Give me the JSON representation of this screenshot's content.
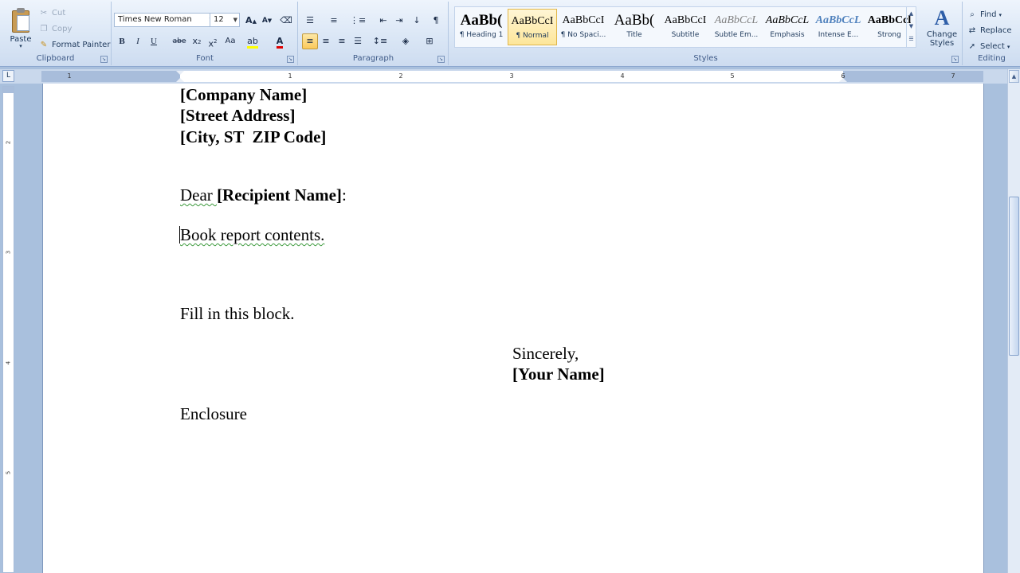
{
  "clipboard": {
    "paste_label": "Paste",
    "cut_label": "Cut",
    "copy_label": "Copy",
    "format_painter_label": "Format Painter",
    "group_label": "Clipboard"
  },
  "font": {
    "family": "Times New Roman",
    "size": "12",
    "group_label": "Font"
  },
  "paragraph": {
    "group_label": "Paragraph"
  },
  "styles": {
    "group_label": "Styles",
    "items": [
      {
        "sample": "AaBb(",
        "name": "¶ Heading 1"
      },
      {
        "sample": "AaBbCcI",
        "name": "¶ Normal"
      },
      {
        "sample": "AaBbCcI",
        "name": "¶ No Spaci..."
      },
      {
        "sample": "AaBb(",
        "name": "Title"
      },
      {
        "sample": "AaBbCcI",
        "name": "Subtitle"
      },
      {
        "sample": "AaBbCcL",
        "name": "Subtle Em..."
      },
      {
        "sample": "AaBbCcL",
        "name": "Emphasis"
      },
      {
        "sample": "AaBbCcL",
        "name": "Intense E..."
      },
      {
        "sample": "AaBbCcl",
        "name": "Strong"
      }
    ],
    "change_styles_line1": "Change",
    "change_styles_line2": "Styles"
  },
  "editing": {
    "find_label": "Find",
    "replace_label": "Replace",
    "select_label": "Select",
    "group_label": "Editing"
  },
  "ruler": {
    "numbers": [
      "1",
      "1",
      "2",
      "3",
      "4",
      "5",
      "6",
      "7"
    ]
  },
  "vruler": {
    "numbers": [
      "2",
      "3",
      "4",
      "5"
    ]
  },
  "document": {
    "company": "[Company Name]",
    "street": "[Street Address]",
    "city": "[City, ST  ZIP Code]",
    "dear": "Dear ",
    "recipient": "[Recipient Name]",
    "colon": ":",
    "body": "Book report contents.",
    "fill": "Fill in this block.",
    "closing": "Sincerely,",
    "your_name": "[Your Name]",
    "enclosure": "Enclosure"
  }
}
